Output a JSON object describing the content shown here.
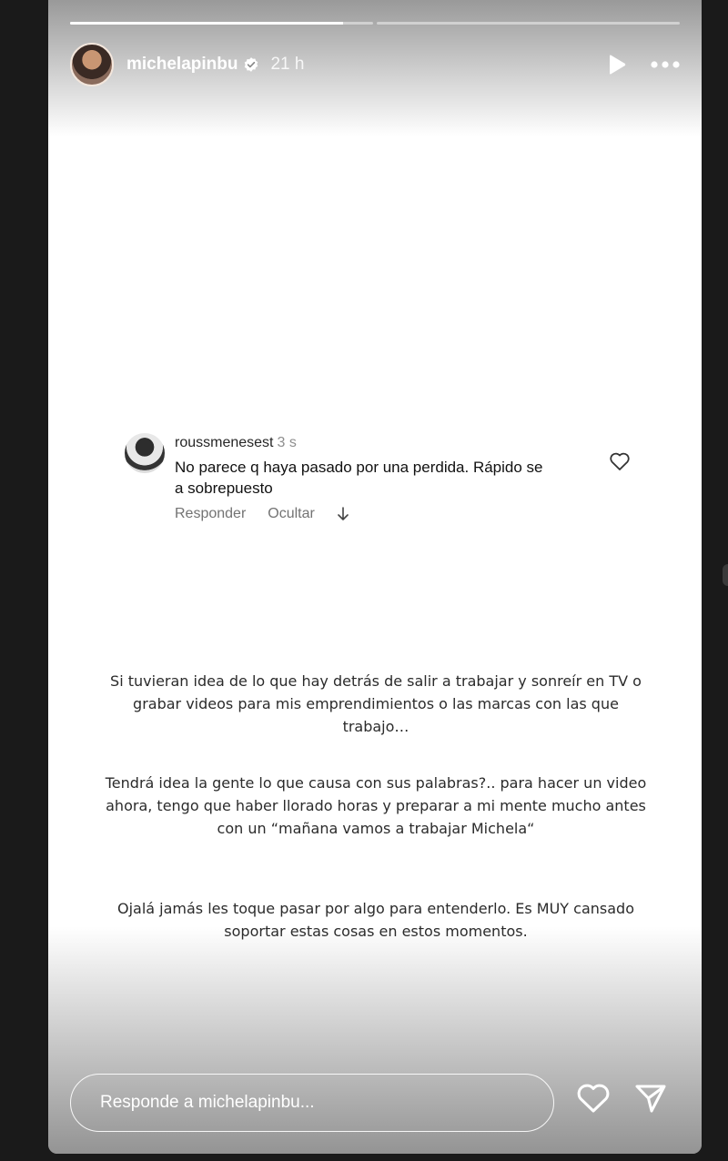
{
  "story": {
    "progress": [
      0.9,
      0.0
    ],
    "username": "michelapinbu",
    "time": "21 h",
    "icons": {
      "verified": "verified-badge-icon",
      "play": "play-icon",
      "more": "more-options-icon"
    }
  },
  "comment": {
    "username": "roussmenesest",
    "time": "3 s",
    "text": "No parece q haya pasado por una perdida.  Rápido se a sobrepuesto",
    "actions": {
      "reply": "Responder",
      "hide": "Ocultar"
    },
    "icons": {
      "like": "heart-outline-icon",
      "expand": "arrow-down-icon"
    }
  },
  "message": {
    "p1": "Si tuvieran idea de lo que hay detrás de salir a trabajar y sonreír en TV o grabar videos para mis emprendimientos o las marcas con las que trabajo…",
    "p2": "Tendrá idea la gente lo que causa con sus palabras?.. para hacer un video ahora, tengo que haber llorado horas y  preparar a mi mente mucho antes con un “mañana vamos a trabajar Michela“",
    "p3": "Ojalá jamás les toque pasar por algo para entenderlo. Es MUY cansado soportar estas cosas en estos momentos."
  },
  "reply": {
    "placeholder": "Responde a michelapinbu...",
    "icons": {
      "like": "heart-icon",
      "send": "send-icon"
    }
  }
}
